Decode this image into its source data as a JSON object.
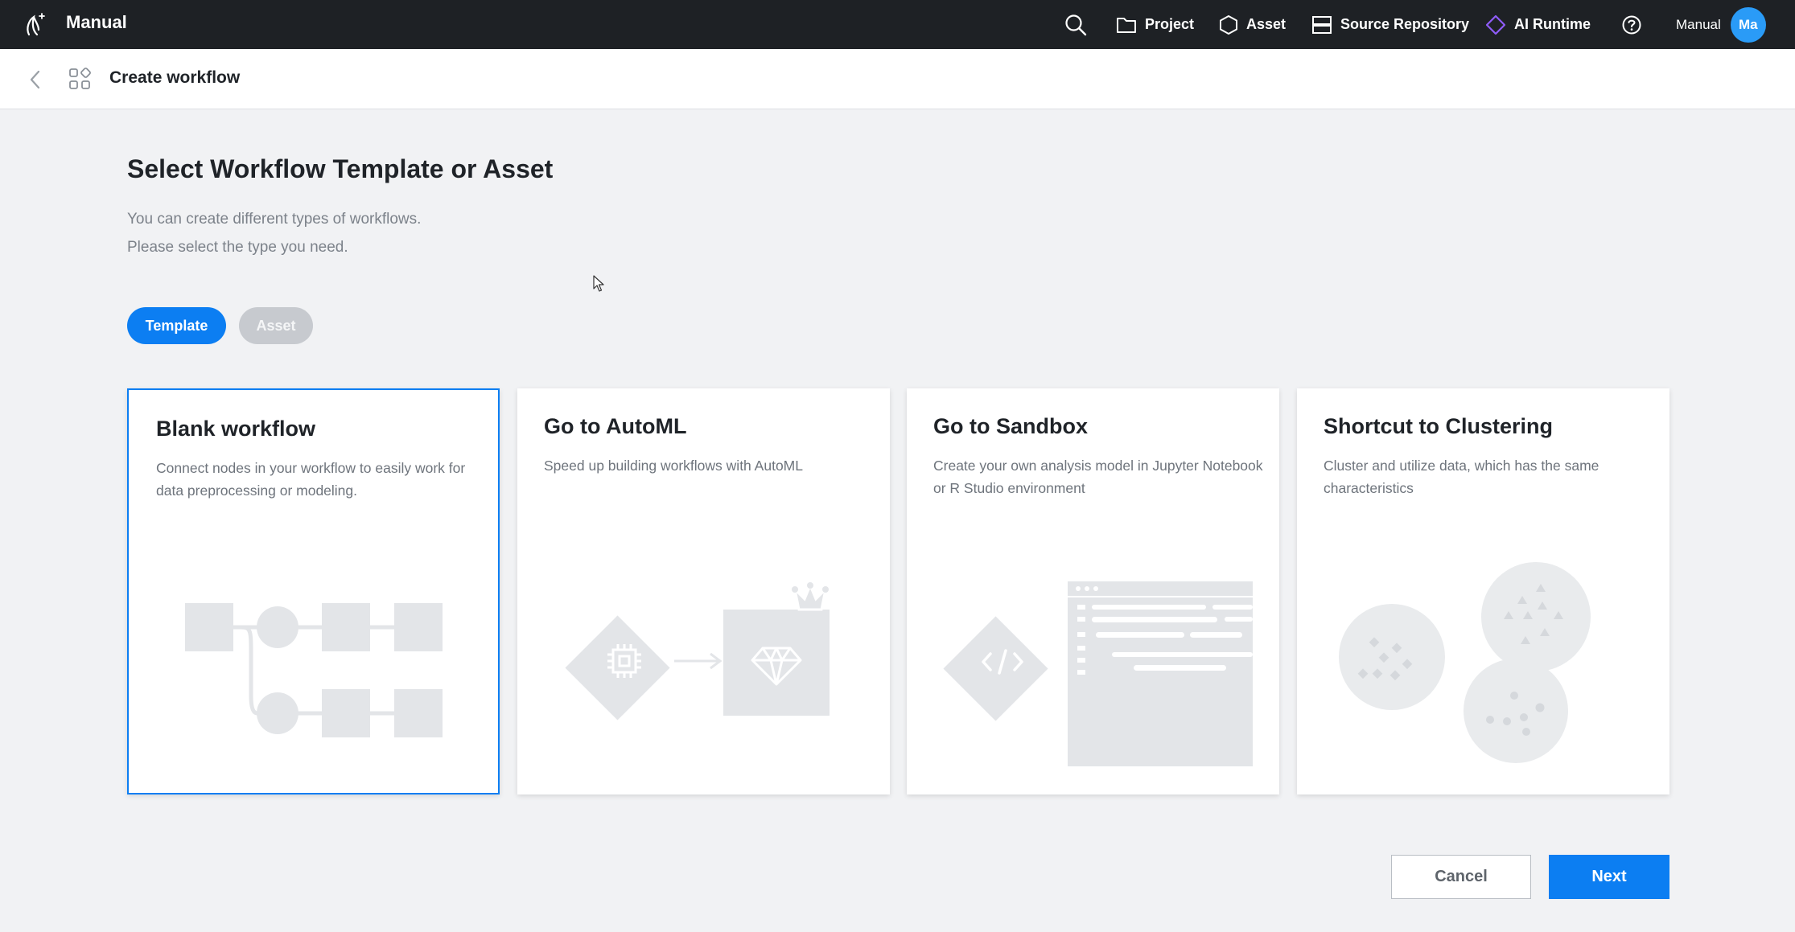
{
  "topbar": {
    "app_title": "Manual",
    "nav": {
      "project": "Project",
      "asset": "Asset",
      "source_repository": "Source Repository",
      "ai_runtime": "AI Runtime"
    },
    "user_name": "Manual",
    "avatar_initials": "Ma",
    "icons": [
      "logo-icon",
      "search-icon",
      "folder-icon",
      "hexagon-icon",
      "server-icon",
      "diamond-icon",
      "help-icon"
    ],
    "accent_color": "#8e5cf7"
  },
  "subheader": {
    "title": "Create workflow"
  },
  "main": {
    "heading": "Select Workflow Template or Asset",
    "description_line1": "You can create different types of workflows.",
    "description_line2": "Please select the type you need.",
    "tabs": [
      {
        "label": "Template",
        "active": true
      },
      {
        "label": "Asset",
        "active": false
      }
    ],
    "cards": [
      {
        "title": "Blank workflow",
        "description": "Connect nodes in your workflow to easily work for data preprocessing or modeling.",
        "selected": true
      },
      {
        "title": "Go to AutoML",
        "description": "Speed up building workflows with AutoML",
        "selected": false
      },
      {
        "title": "Go to Sandbox",
        "description": "Create your own analysis model in Jupyter Notebook or R Studio environment",
        "selected": false
      },
      {
        "title": "Shortcut to Clustering",
        "description": "Cluster and utilize data, which has the same characteristics",
        "selected": false
      }
    ]
  },
  "footer": {
    "cancel_label": "Cancel",
    "next_label": "Next"
  },
  "colors": {
    "primary": "#0c7ef2",
    "topbar_bg": "#1e2125",
    "page_bg": "#f1f2f4"
  }
}
